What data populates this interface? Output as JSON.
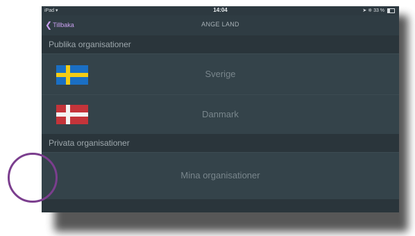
{
  "status_bar": {
    "device": "iPad",
    "time": "14:04",
    "battery": "33 %"
  },
  "nav": {
    "back_label": "Tillbaka",
    "title": "ANGE LAND"
  },
  "sections": {
    "public_header": "Publika organisationer",
    "private_header": "Privata organisationer"
  },
  "countries": [
    {
      "label": "Sverige",
      "flag": "sweden-flag"
    },
    {
      "label": "Danmark",
      "flag": "denmark-flag"
    }
  ],
  "private_item": {
    "label": "Mina organisationer"
  },
  "colors": {
    "background": "#2d3940",
    "row": "#34434a",
    "accent_back": "#c9a0f0",
    "touch_indicator": "#7b3e8e"
  }
}
